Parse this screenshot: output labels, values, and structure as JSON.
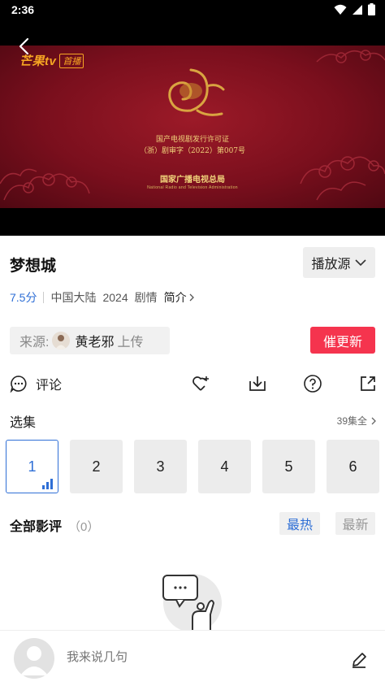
{
  "status_bar": {
    "time": "2:36"
  },
  "video": {
    "brand_logo": "芒果tv",
    "brand_live": "首播",
    "license_line1": "国产电视剧发行许可证",
    "license_line2": "（浙）剧审字（2022）第007号",
    "authority": "国家广播电视总局",
    "authority_en": "National Radio and Television Administration"
  },
  "show": {
    "title": "梦想城",
    "source_button": "播放源",
    "rating": "7.5分",
    "region": "中国大陆",
    "year": "2024",
    "genre": "剧情",
    "intro_label": "简介"
  },
  "uploader": {
    "prefix": "来源:",
    "name": "黄老邪",
    "suffix": "上传"
  },
  "urge_button": "催更新",
  "actions": {
    "comment_label": "评论"
  },
  "episodes": {
    "title": "选集",
    "count_label": "39集全",
    "items": [
      "1",
      "2",
      "3",
      "4",
      "5",
      "6"
    ],
    "active_index": 0
  },
  "reviews": {
    "title": "全部影评",
    "count": "（0）",
    "sort_hot": "最热",
    "sort_new": "最新"
  },
  "bottom_bar": {
    "placeholder": "我来说几句"
  },
  "colors": {
    "accent_blue": "#2f6fd6",
    "urge_red": "#f5344e",
    "video_red": "#7a0f1d",
    "gold": "#f0d27a"
  }
}
